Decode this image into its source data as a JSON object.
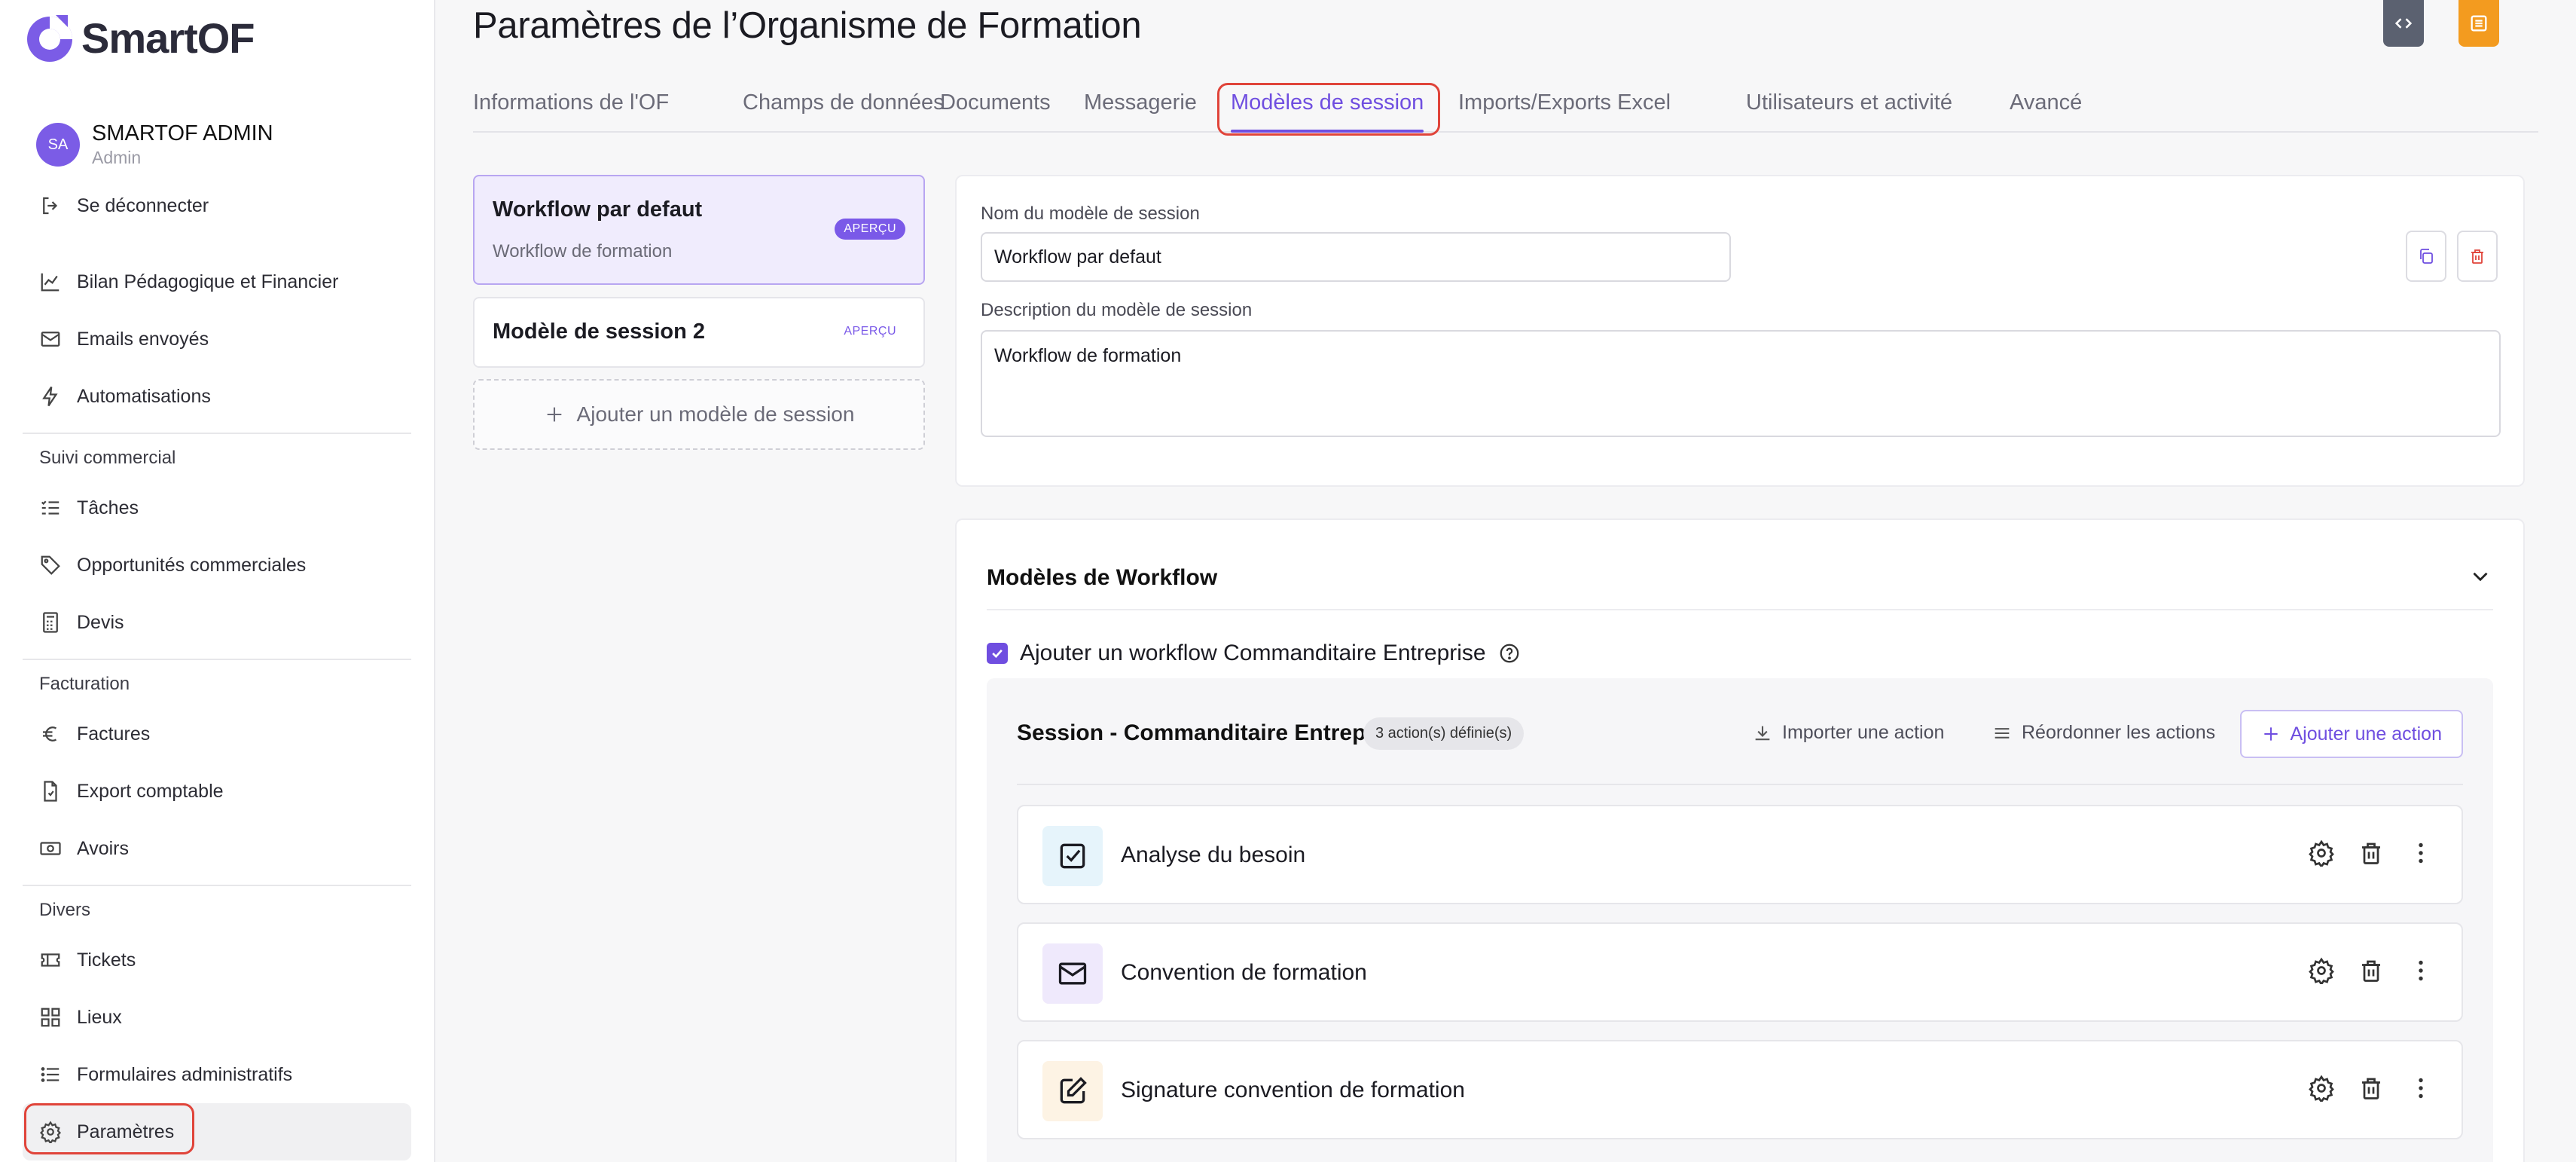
{
  "brand": {
    "name": "SmartOF",
    "accent": "#6f4ee0",
    "logo_color": "#7b5ce6"
  },
  "user": {
    "initials": "SA",
    "name": "SMARTOF ADMIN",
    "role": "Admin"
  },
  "sidebar": {
    "logout_label": "Se déconnecter",
    "items_top": [
      {
        "label": "Bilan Pédagogique et Financier",
        "icon": "chart-line-icon"
      },
      {
        "label": "Emails envoyés",
        "icon": "mail-icon"
      },
      {
        "label": "Automatisations",
        "icon": "bolt-icon"
      }
    ],
    "sections": [
      {
        "title": "Suivi commercial",
        "items": [
          {
            "label": "Tâches",
            "icon": "list-check-icon"
          },
          {
            "label": "Opportunités commerciales",
            "icon": "tag-icon"
          },
          {
            "label": "Devis",
            "icon": "calculator-icon"
          }
        ]
      },
      {
        "title": "Facturation",
        "items": [
          {
            "label": "Factures",
            "icon": "euro-icon"
          },
          {
            "label": "Export comptable",
            "icon": "file-export-icon"
          },
          {
            "label": "Avoirs",
            "icon": "banknote-icon"
          }
        ]
      },
      {
        "title": "Divers",
        "items": [
          {
            "label": "Tickets",
            "icon": "ticket-icon"
          },
          {
            "label": "Lieux",
            "icon": "grid-icon"
          },
          {
            "label": "Formulaires administratifs",
            "icon": "list-icon"
          },
          {
            "label": "Paramètres",
            "icon": "gear-icon",
            "active": true
          }
        ]
      }
    ]
  },
  "header": {
    "title": "Paramètres de l’Organisme de Formation",
    "code_button_icon": "code-icon",
    "menu_button_icon": "list-icon",
    "code_button_color": "#5b6170",
    "menu_button_color": "#f39b1f"
  },
  "tabs": [
    {
      "label": "Informations de l'OF",
      "active": false
    },
    {
      "label": "Champs de données",
      "active": false
    },
    {
      "label": "Documents",
      "active": false
    },
    {
      "label": "Messagerie",
      "active": false
    },
    {
      "label": "Modèles de session",
      "active": true
    },
    {
      "label": "Imports/Exports Excel",
      "active": false
    },
    {
      "label": "Utilisateurs et activité",
      "active": false
    },
    {
      "label": "Avancé",
      "active": false
    }
  ],
  "models": [
    {
      "title": "Workflow par defaut",
      "subtitle": "Workflow de formation",
      "badge": "APERÇU",
      "selected": true
    },
    {
      "title": "Modèle de session 2",
      "subtitle": "",
      "badge": "APERÇU",
      "selected": false
    }
  ],
  "add_model_label": "Ajouter un modèle de session",
  "form": {
    "name_label": "Nom du modèle de session",
    "name_value": "Workflow par defaut",
    "description_label": "Description du modèle de session",
    "description_value": "Workflow de formation"
  },
  "workflow": {
    "title": "Modèles de Workflow",
    "checkbox_label": "Ajouter un workflow Commanditaire Entreprise",
    "checkbox_checked": true,
    "session": {
      "title": "Session - Commanditaire Entreprise",
      "badge": "3 action(s) définie(s)",
      "import_label": "Importer une action",
      "reorder_label": "Réordonner les actions",
      "add_label": "Ajouter une action",
      "actions": [
        {
          "label": "Analyse du besoin",
          "icon": "checkbox-icon",
          "tint": "#e6f4fb"
        },
        {
          "label": "Convention de formation",
          "icon": "mail-icon",
          "tint": "#efe9fc"
        },
        {
          "label": "Signature convention de formation",
          "icon": "pen-square-icon",
          "tint": "#fdf3e4"
        }
      ]
    }
  }
}
